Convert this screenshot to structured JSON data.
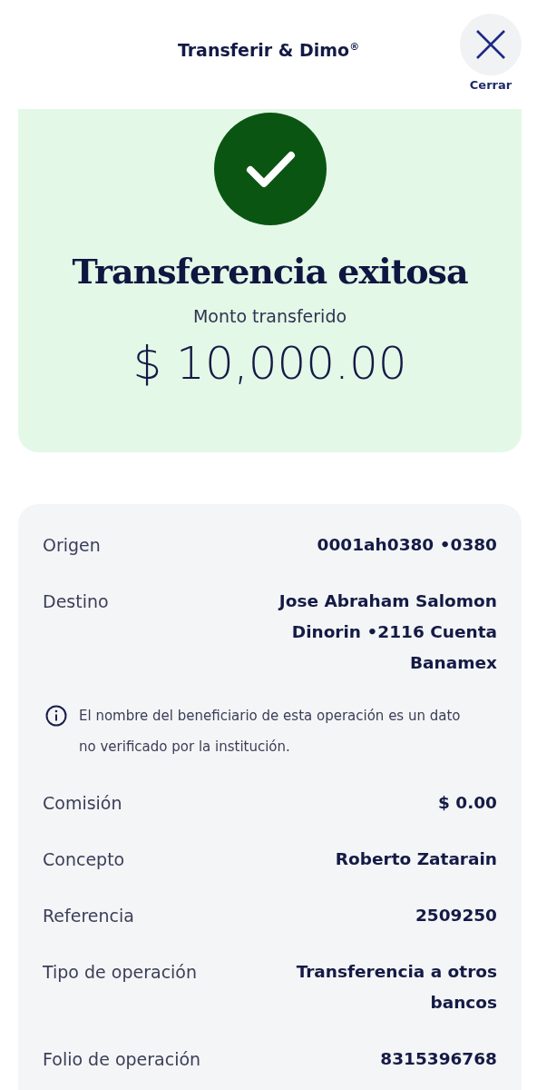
{
  "header": {
    "title": "Transferir & Dimo$^{®}$",
    "close_label": "Cerrar"
  },
  "success": {
    "title": "Transferencia exitosa",
    "amount_label": "Monto transferido",
    "amount": "$ 10,000.00"
  },
  "details": [
    {
      "kind": "field",
      "label": "Origen",
      "value": "0001ah0380 •0380"
    },
    {
      "kind": "field",
      "label": "Destino",
      "value": "Jose Abraham Salomon Dinorin •2116 Cuenta Banamex"
    },
    {
      "kind": "notice",
      "text": "El nombre del beneficiario de esta operación es un dato no verificado por la institución."
    },
    {
      "kind": "field",
      "label": "Comisión",
      "value": "$ 0.00"
    },
    {
      "kind": "field",
      "label": "Concepto",
      "value": "Roberto Zatarain"
    },
    {
      "kind": "field",
      "label": "Referencia",
      "value": "2509250"
    },
    {
      "kind": "field",
      "label": "Tipo de operación",
      "value": "Transferencia a otros bancos"
    },
    {
      "kind": "field",
      "label": "Folio de operación",
      "value": "8315396768"
    }
  ]
}
